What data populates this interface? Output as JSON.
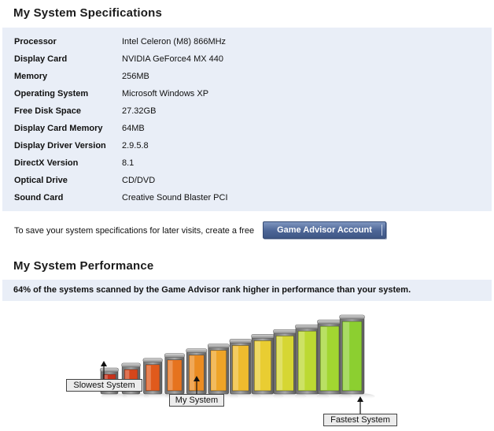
{
  "specs": {
    "title": "My System Specifications",
    "rows": [
      {
        "label": "Processor",
        "value": "Intel Celeron (M8) 866MHz"
      },
      {
        "label": "Display Card",
        "value": "NVIDIA GeForce4 MX 440"
      },
      {
        "label": "Memory",
        "value": "256MB"
      },
      {
        "label": "Operating System",
        "value": "Microsoft Windows XP"
      },
      {
        "label": "Free Disk Space",
        "value": "27.32GB"
      },
      {
        "label": "Display Card Memory",
        "value": "64MB"
      },
      {
        "label": "Display Driver Version",
        "value": "2.9.5.8"
      },
      {
        "label": "DirectX Version",
        "value": "8.1"
      },
      {
        "label": "Optical Drive",
        "value": "CD/DVD"
      },
      {
        "label": "Sound Card",
        "value": "Creative Sound Blaster PCI"
      }
    ]
  },
  "save_prompt": {
    "text": "To save your system specifications for later visits, create a free",
    "button_label": "Game Advisor Account"
  },
  "performance": {
    "title": "My System Performance",
    "summary": "64% of the systems scanned by the Game Advisor rank higher in performance than your system.",
    "bars": 12,
    "my_system_index": 4,
    "labels": {
      "slowest": "Slowest System",
      "mine": "My System",
      "fastest": "Fastest System"
    },
    "colors": [
      "#c8321b",
      "#d6461b",
      "#e05a1c",
      "#e6731e",
      "#eb8c22",
      "#eea428",
      "#efbb2e",
      "#e9cd32",
      "#d6d633",
      "#bcd932",
      "#a2d631",
      "#8ccf30"
    ]
  }
}
